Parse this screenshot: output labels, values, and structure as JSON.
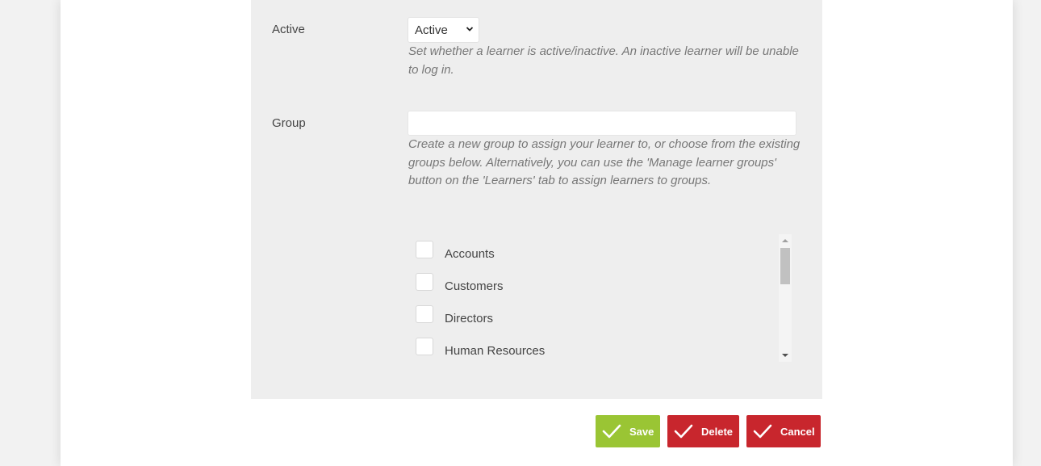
{
  "active_field": {
    "label": "Active",
    "selected": "Active",
    "help": "Set whether a learner is active/inactive. An inactive learner will be unable to log in."
  },
  "group_field": {
    "label": "Group",
    "input_value": "",
    "help": "Create a new group to assign your learner to, or choose from the existing groups below. Alternatively, you can use the 'Manage learner groups' button on the 'Learners' tab to assign learners to groups.",
    "groups": [
      {
        "label": "Accounts",
        "checked": false
      },
      {
        "label": "Customers",
        "checked": false
      },
      {
        "label": "Directors",
        "checked": false
      },
      {
        "label": "Human Resources",
        "checked": false
      }
    ]
  },
  "actions": {
    "save_label": "Save",
    "delete_label": "Delete",
    "cancel_label": "Cancel"
  },
  "colors": {
    "panel_bg": "#eeeeee",
    "save_green": "#9ac534",
    "danger_red": "#c8262d"
  },
  "icons": {
    "select": "chevron-down-icon",
    "buttons": "checkmark-icon"
  }
}
